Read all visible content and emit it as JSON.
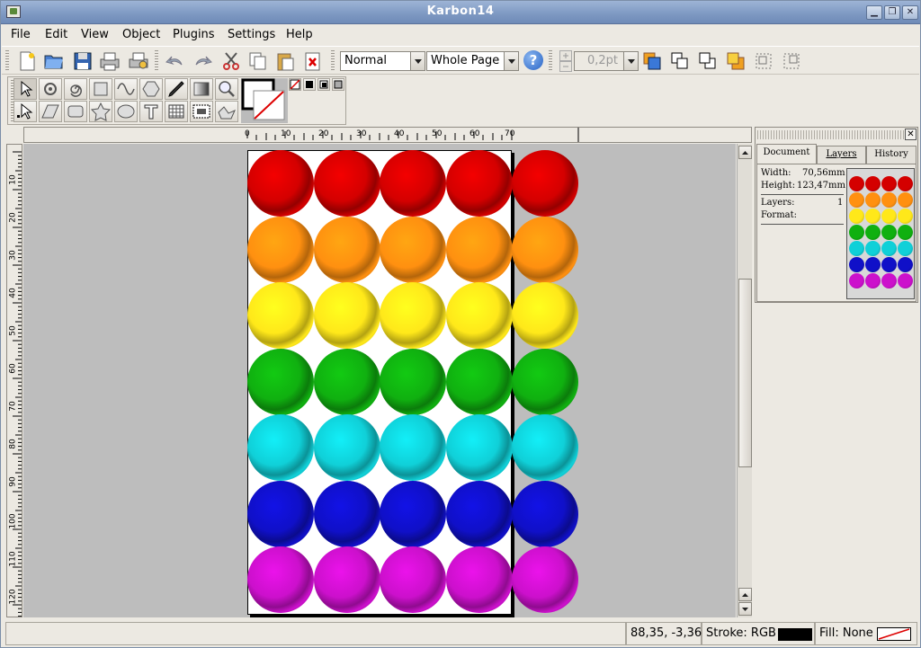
{
  "window": {
    "title": "Karbon14"
  },
  "menu": {
    "items": [
      {
        "label": "File"
      },
      {
        "label": "Edit"
      },
      {
        "label": "View"
      },
      {
        "label": "Object"
      },
      {
        "label": "Plugins"
      },
      {
        "label": "Settings"
      },
      {
        "label": "Help"
      }
    ]
  },
  "toolbar": {
    "blend_mode": "Normal",
    "zoom": "Whole Page",
    "stroke_width": "0,2pt"
  },
  "ruler": {
    "top_labels": [
      "0",
      "10",
      "20",
      "30",
      "40",
      "50",
      "60",
      "70"
    ],
    "left_labels": [
      "10",
      "20",
      "30",
      "40",
      "50",
      "60",
      "70",
      "80",
      "90",
      "100",
      "110",
      "120"
    ]
  },
  "docker": {
    "tabs": [
      {
        "label": "Document"
      },
      {
        "label": "Layers"
      },
      {
        "label": "History"
      }
    ],
    "width_label": "Width:",
    "width_value": "70,56mm",
    "height_label": "Height:",
    "height_value": "123,47mm",
    "layers_label": "Layers:",
    "layers_value": "1",
    "format_label": "Format:"
  },
  "canvas": {
    "row_colors": [
      "#d40000",
      "#ff9010",
      "#ffe81a",
      "#10b010",
      "#10d0d8",
      "#1010c8",
      "#cc10cc"
    ]
  },
  "status": {
    "coords": "88,35, -3,36",
    "stroke_label": "Stroke: RGB",
    "stroke_color": "#000000",
    "fill_label": "Fill: None"
  }
}
